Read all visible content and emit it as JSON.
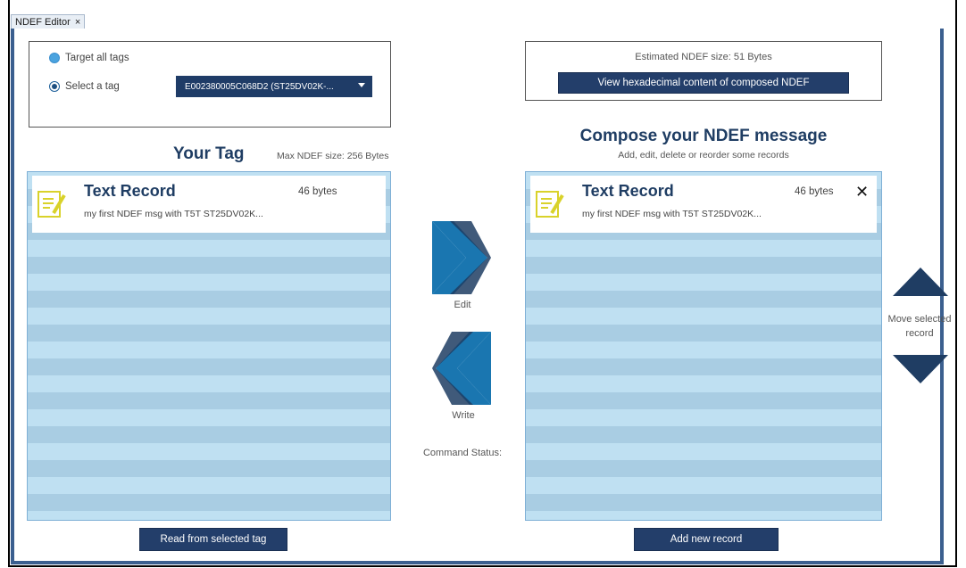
{
  "tab": {
    "label": "NDEF Editor",
    "close": "×"
  },
  "target": {
    "option_all": "Target all tags",
    "option_select": "Select a tag",
    "selected_tag": "E002380005C068D2 (ST25DV02K-..."
  },
  "estimate": {
    "size_text": "Estimated NDEF size: 51 Bytes",
    "hex_button": "View hexadecimal content of composed NDEF"
  },
  "your_tag": {
    "title": "Your Tag",
    "max_size": "Max NDEF size: 256 Bytes",
    "record": {
      "title": "Text Record",
      "size": "46 bytes",
      "text": "my first NDEF msg with T5T ST25DV02K..."
    },
    "read_button": "Read from selected tag"
  },
  "compose": {
    "title": "Compose your NDEF message",
    "subtitle": "Add, edit, delete or reorder some records",
    "record": {
      "title": "Text Record",
      "size": "46 bytes",
      "text": "my first NDEF msg with T5T ST25DV02K...",
      "close": "✕"
    },
    "add_button": "Add new record"
  },
  "actions": {
    "edit_label": "Edit",
    "write_label": "Write",
    "command_status": "Command Status:"
  },
  "move": {
    "label_line1": "Move selected",
    "label_line2": "record"
  },
  "colors": {
    "navy": "#1f3d63",
    "accent_blue": "#1a76b0",
    "list_light": "#bfe0f2",
    "list_dark": "#a9cde3",
    "icon_yellow": "#d9d22a"
  }
}
